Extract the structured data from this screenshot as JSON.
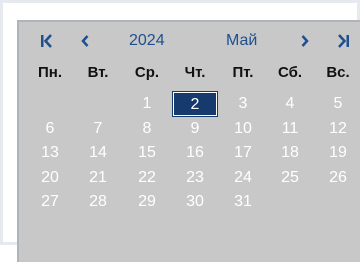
{
  "header": {
    "first_icon": "double-chevron-left-icon",
    "prev_icon": "chevron-left-icon",
    "year": "2024",
    "month": "Май",
    "next_icon": "chevron-right-icon",
    "last_icon": "double-chevron-right-icon"
  },
  "weekdays": [
    "Пн.",
    "Вт.",
    "Ср.",
    "Чт.",
    "Пт.",
    "Сб.",
    "Вс."
  ],
  "weeks": [
    [
      "",
      "",
      "1",
      "2",
      "3",
      "4",
      "5"
    ],
    [
      "6",
      "7",
      "8",
      "9",
      "10",
      "11",
      "12"
    ],
    [
      "13",
      "14",
      "15",
      "16",
      "17",
      "18",
      "19"
    ],
    [
      "20",
      "21",
      "22",
      "23",
      "24",
      "25",
      "26"
    ],
    [
      "27",
      "28",
      "29",
      "30",
      "31",
      "",
      ""
    ]
  ],
  "selected_day": "2",
  "colors": {
    "accent": "#1d4f91",
    "selected_bg": "#173a6e",
    "calendar_bg": "#c8c8c8",
    "day_text": "#ffffff"
  }
}
